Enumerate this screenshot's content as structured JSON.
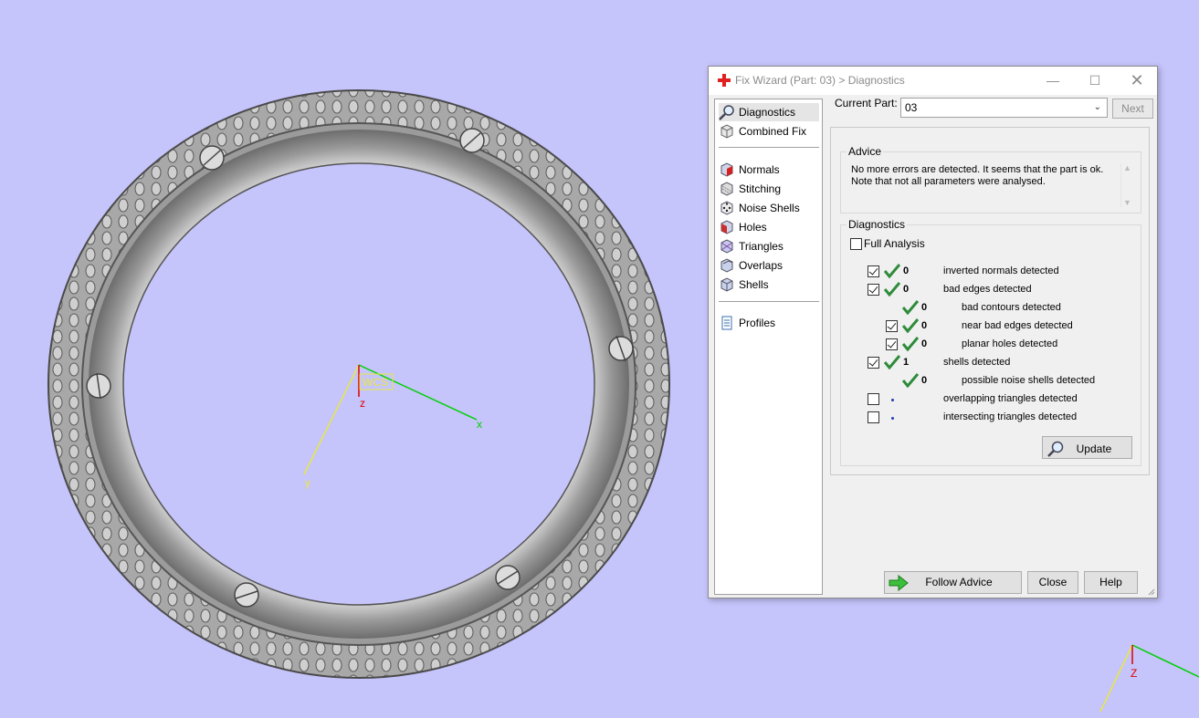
{
  "dialog": {
    "title": "Fix Wizard (Part: 03) > Diagnostics",
    "icon": "red-cross-icon"
  },
  "nav": {
    "items": [
      {
        "label": "Diagnostics",
        "icon": "magnifier-icon"
      },
      {
        "label": "Combined Fix",
        "icon": "cube-icon"
      },
      {
        "label": "Normals",
        "icon": "normals-cube-icon"
      },
      {
        "label": "Stitching",
        "icon": "stitching-cube-icon"
      },
      {
        "label": "Noise Shells",
        "icon": "dice-icon"
      },
      {
        "label": "Holes",
        "icon": "holes-cube-icon"
      },
      {
        "label": "Triangles",
        "icon": "triangles-cube-icon"
      },
      {
        "label": "Overlaps",
        "icon": "overlaps-cube-icon"
      },
      {
        "label": "Shells",
        "icon": "shells-cube-icon"
      },
      {
        "label": "Profiles",
        "icon": "document-icon"
      }
    ]
  },
  "toolbar": {
    "current_part_label": "Current Part:",
    "current_part_value": "03",
    "next_label": "Next"
  },
  "advice": {
    "title": "Advice",
    "text": "No more errors are detected. It seems that the part is ok. Note that not all parameters were analysed."
  },
  "diagnostics": {
    "title": "Diagnostics",
    "full_analysis_label": "Full Analysis",
    "rows": [
      {
        "count": "0",
        "label": "inverted normals detected"
      },
      {
        "count": "0",
        "label": "bad edges detected"
      },
      {
        "count": "0",
        "label": "bad contours detected"
      },
      {
        "count": "0",
        "label": "near bad edges detected"
      },
      {
        "count": "0",
        "label": "planar holes detected"
      },
      {
        "count": "1",
        "label": "shells detected"
      },
      {
        "count": "0",
        "label": "possible noise shells detected"
      },
      {
        "count": "",
        "label": "overlapping triangles detected"
      },
      {
        "count": "",
        "label": "intersecting triangles detected"
      }
    ],
    "update_label": "Update"
  },
  "footer": {
    "follow_advice_label": "Follow Advice",
    "close_label": "Close",
    "help_label": "Help"
  },
  "viewport": {
    "axis_x": "x",
    "axis_y": "y",
    "axis_z": "z",
    "wcs_label": "WCS",
    "corner_axis_z": "Z"
  },
  "colors": {
    "background": "#c5c4fb",
    "check_green": "#2e8b3a",
    "axis_x": "#00d000",
    "axis_y": "#e8e840",
    "axis_z": "#e00000"
  }
}
